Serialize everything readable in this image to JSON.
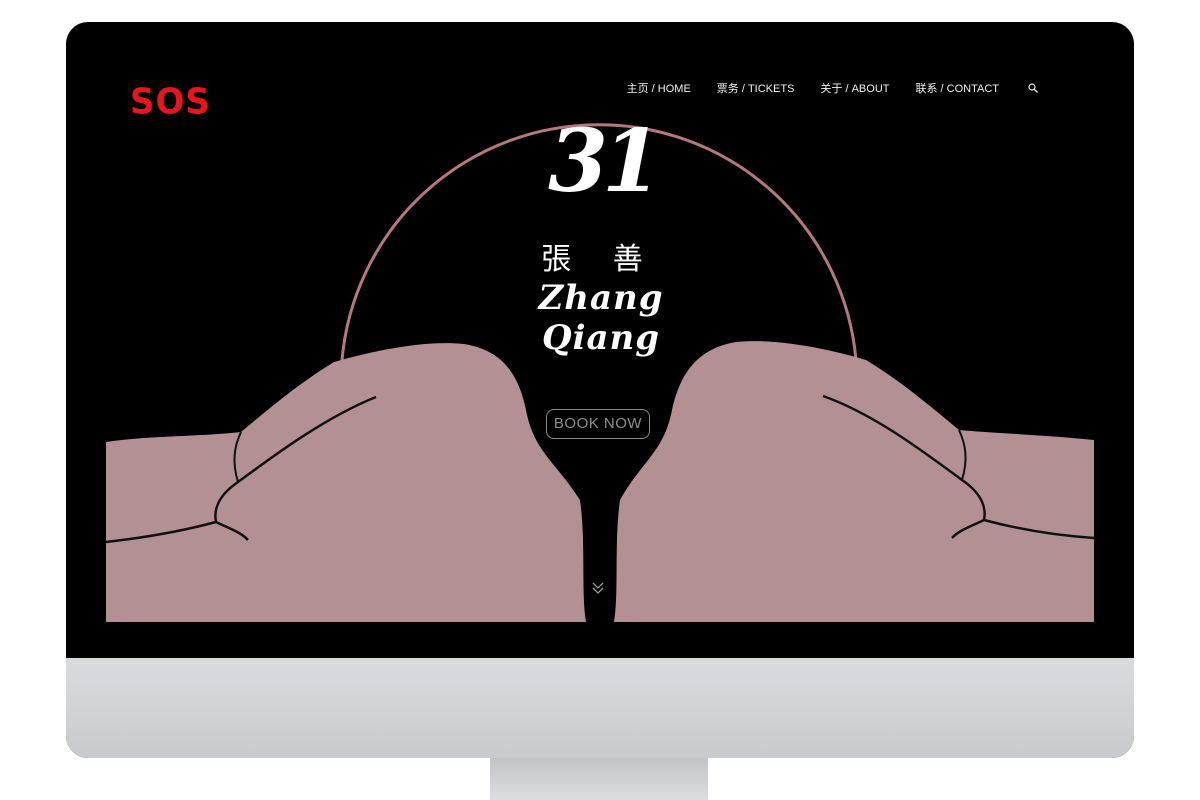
{
  "logo": {
    "text": "SOS",
    "color": "#e8141e"
  },
  "nav": {
    "items": [
      {
        "label": "主页 / HOME"
      },
      {
        "label": "票务 / TICKETS"
      },
      {
        "label": "关于 / ABOUT"
      },
      {
        "label": "联系 / CONTACT"
      }
    ],
    "search_icon": "search-icon"
  },
  "hero": {
    "number": "31",
    "name_cn": "張 善",
    "name_en": "Zhang Qiang",
    "book_button": "BOOK NOW",
    "scroll_icon": "double-chevron-down-icon"
  },
  "colors": {
    "background": "#000000",
    "glove": "#b39094",
    "arc": "#b57880",
    "text": "#ffffff"
  }
}
